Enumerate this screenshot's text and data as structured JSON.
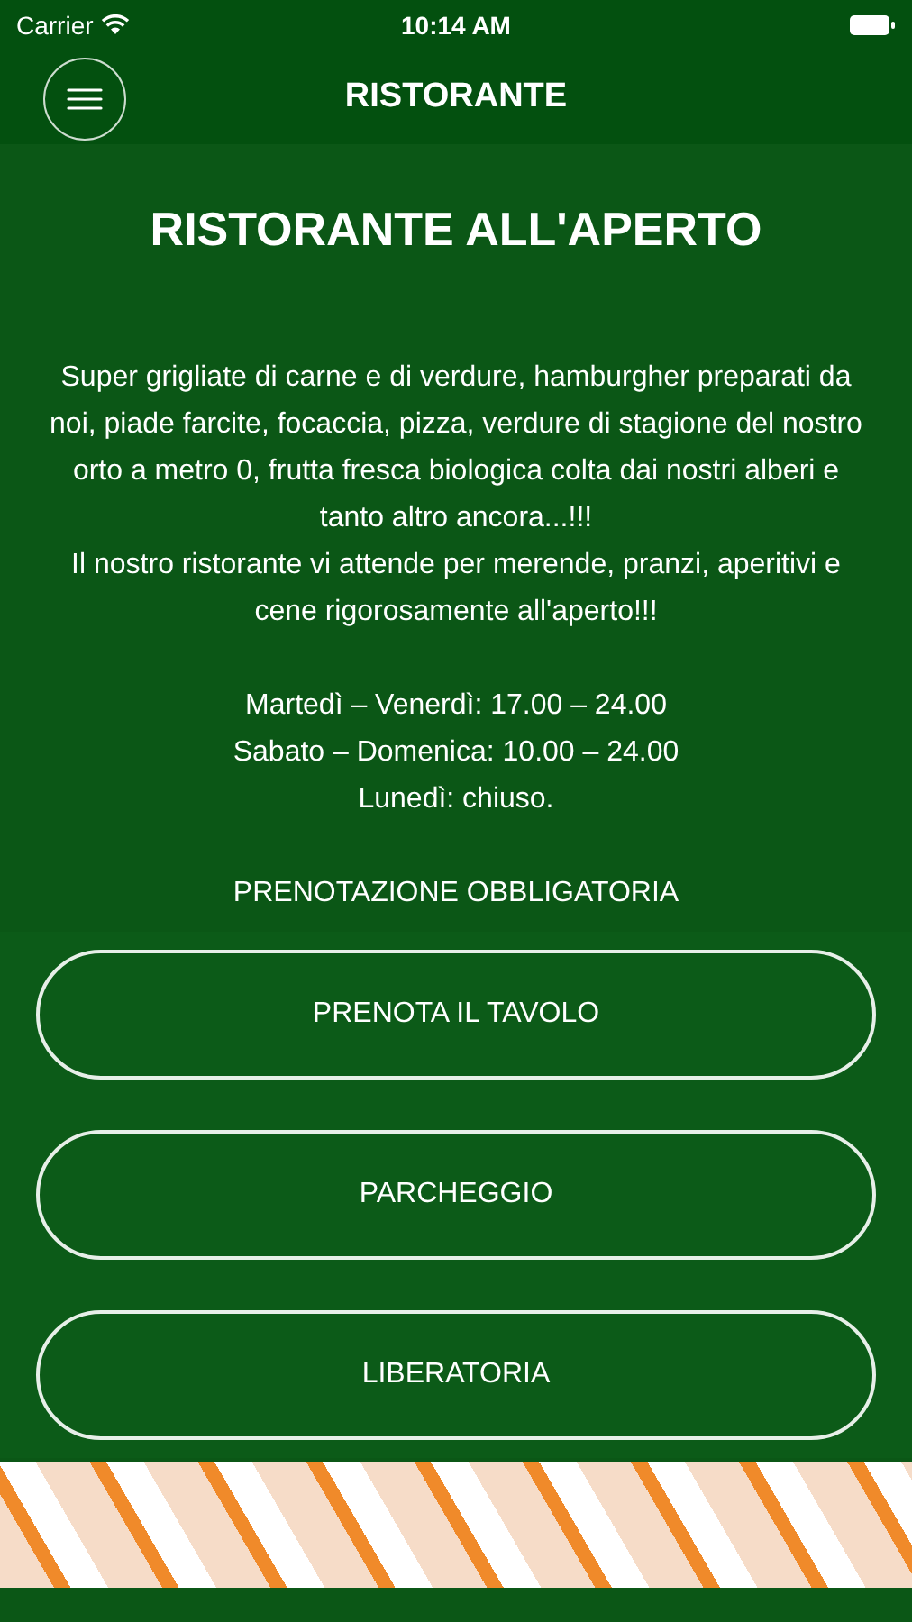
{
  "status_bar": {
    "carrier": "Carrier",
    "time": "10:14 AM"
  },
  "nav": {
    "title": "RISTORANTE"
  },
  "heading": "RISTORANTE ALL'APERTO",
  "description": [
    "Super grigliate di carne e di verdure, hamburgher preparati da noi, piade farcite, focaccia, pizza, verdure di stagione del nostro orto a metro 0, frutta fresca biologica colta dai nostri alberi e tanto altro ancora...!!!",
    "Il nostro ristorante vi attende per merende, pranzi, aperitivi e cene rigorosamente all'aperto!!!"
  ],
  "hours": [
    "Martedì – Venerdì: 17.00 – 24.00",
    "Sabato – Domenica: 10.00 – 24.00",
    "Lunedì: chiuso."
  ],
  "notice": "PRENOTAZIONE OBBLIGATORIA",
  "buttons": [
    "PRENOTA IL TAVOLO",
    "PARCHEGGIO",
    "LIBERATORIA"
  ]
}
